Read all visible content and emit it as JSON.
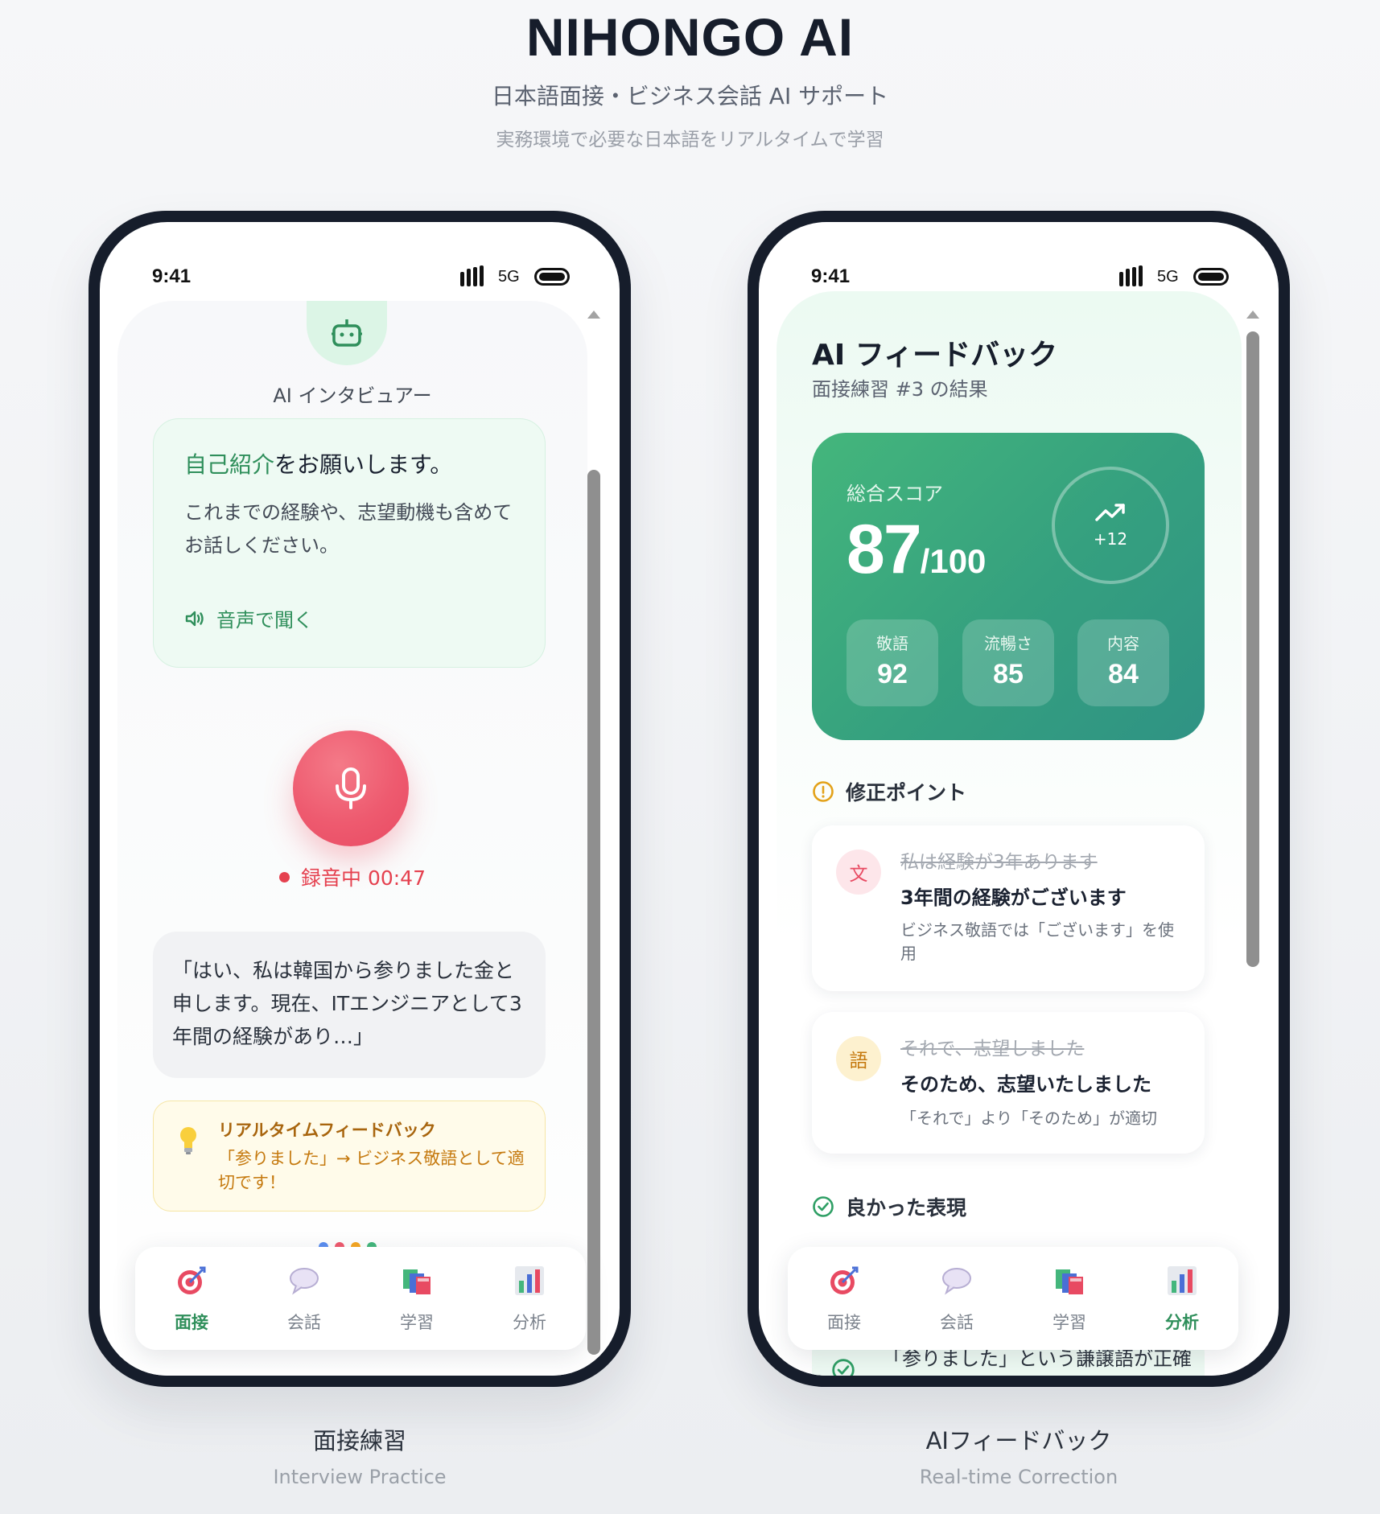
{
  "header": {
    "title": "NIHONGO AI",
    "subtitle": "日本語面接・ビジネス会話 AI サポート",
    "tagline": "実務環境で必要な日本語をリアルタイムで学習"
  },
  "status_bar": {
    "time": "9:41",
    "network": "5G"
  },
  "interview_screen": {
    "interviewer_label": "AI インタビュアー",
    "question": {
      "title_highlight": "自己紹介",
      "title_rest": "をお願いします。",
      "body": "これまでの経験や、志望動機も含めてお話しください。",
      "listen_label": "音声で聞く"
    },
    "recording_label": "録音中 00:47",
    "transcript": "「はい、私は韓国から参りました金と申します。現在、ITエンジニアとして3年間の経験があり…」",
    "realtime_feedback": {
      "title": "リアルタイムフィードバック",
      "body": "「参りました」→ ビジネス敬語として適切です！"
    }
  },
  "feedback_screen": {
    "title": "AI フィードバック",
    "subtitle": "面接練習 #3 の結果",
    "score": {
      "label": "総合スコア",
      "value": "87",
      "max": "/100",
      "delta": "+12",
      "sub_scores": [
        {
          "label": "敬語",
          "value": "92"
        },
        {
          "label": "流暢さ",
          "value": "85"
        },
        {
          "label": "内容",
          "value": "84"
        }
      ]
    },
    "corrections_heading": "修正ポイント",
    "corrections": [
      {
        "badge": "文",
        "original": "私は経験が3年あります",
        "corrected": "3年間の経験がございます",
        "note": "ビジネス敬語では「ございます」を使用"
      },
      {
        "badge": "語",
        "original": "それで、志望しました",
        "corrected": "そのため、志望いたしました",
        "note": "「それで」より「そのため」が適切"
      }
    ],
    "good_heading": "良かった表現",
    "good_items": [
      {
        "text": "「参りました」という謙譲語が正確です"
      }
    ]
  },
  "tabs": [
    {
      "label": "面接",
      "icon": "target-icon"
    },
    {
      "label": "会話",
      "icon": "speech-bubble-icon"
    },
    {
      "label": "学習",
      "icon": "books-icon"
    },
    {
      "label": "分析",
      "icon": "bar-chart-icon"
    }
  ],
  "captions": {
    "left": {
      "jp": "面接練習",
      "en": "Interview Practice"
    },
    "right": {
      "jp": "AIフィードバック",
      "en": "Real-time Correction"
    }
  },
  "colors": {
    "accent_green": "#2f8f5b",
    "record_red": "#e5414f",
    "warning_amber": "#c5790e",
    "score_gradient_start": "#44b67c",
    "score_gradient_end": "#2f9384"
  }
}
